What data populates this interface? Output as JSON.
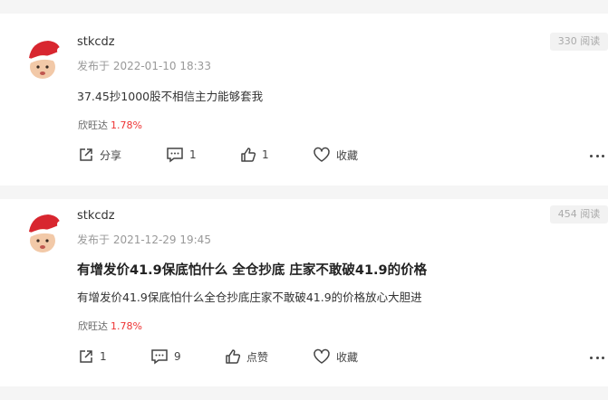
{
  "posts": [
    {
      "username": "stkcdz",
      "time": "发布于 2022-01-10 18:33",
      "read_count": "330 阅读",
      "title": "",
      "body": "37.45抄1000股不相信主力能够套我",
      "stock": {
        "name": "欣旺达",
        "change": "1.78%",
        "change_color": "#e33333"
      },
      "actions": {
        "share": "分享",
        "comment": "1",
        "like": "1",
        "favorite": "收藏"
      },
      "icons": [
        "share-icon",
        "comment-icon",
        "thumbs-up-icon",
        "heart-icon",
        "more-dots-icon"
      ]
    },
    {
      "username": "stkcdz",
      "time": "发布于 2021-12-29 19:45",
      "read_count": "454 阅读",
      "title": "有增发价41.9保底怕什么 全仓抄底 庄家不敢破41.9的价格",
      "body": "有增发价41.9保底怕什么全仓抄底庄家不敢破41.9的价格放心大胆进",
      "stock": {
        "name": "欣旺达",
        "change": "1.78%",
        "change_color": "#e33333"
      },
      "actions": {
        "share": "1",
        "comment": "9",
        "like": "点赞",
        "favorite": "收藏"
      },
      "icons": [
        "share-icon",
        "comment-icon",
        "thumbs-up-icon",
        "heart-icon",
        "more-dots-icon"
      ]
    }
  ]
}
